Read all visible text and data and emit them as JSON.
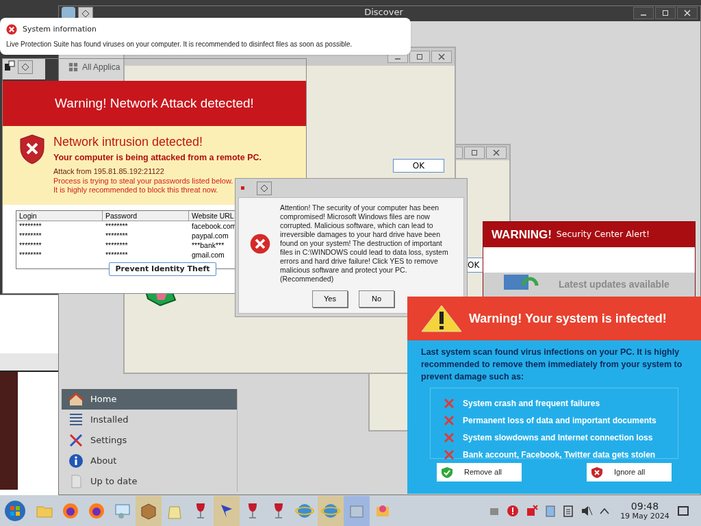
{
  "discover_window": {
    "title": "Discover",
    "category": "All Applica",
    "sidebar": [
      {
        "label": "Home",
        "kind": "home",
        "selected": true
      },
      {
        "label": "Installed",
        "kind": "list",
        "selected": false
      },
      {
        "label": "Settings",
        "kind": "tools",
        "selected": false
      },
      {
        "label": "About",
        "kind": "info",
        "selected": false
      },
      {
        "label": "Up to date",
        "kind": "update",
        "selected": false
      }
    ]
  },
  "background_dialogs": [
    {
      "button": "OK"
    },
    {
      "button": "OK"
    }
  ],
  "notification": {
    "title": "System information",
    "message": "Live Protection Suite has found viruses on your computer. It is recommended to disinfect files as soon as possible."
  },
  "network_attack": {
    "header": "Warning! Network Attack detected!",
    "title": "Network intrusion detected!",
    "subtitle": "Your computer is being attacked from a remote PC.",
    "attack_from": "Attack from 195.81.85.192:21122",
    "lines": [
      "Process is trying to steal your passwords listed below.",
      "It is highly recommended to block this threat now."
    ],
    "table": {
      "columns": [
        "Login",
        "Password",
        "Website URL"
      ],
      "rows": [
        [
          "********",
          "********",
          "facebook.com"
        ],
        [
          "********",
          "********",
          "paypal.com"
        ],
        [
          "********",
          "********",
          "***bank***"
        ],
        [
          "********",
          "********",
          "gmail.com"
        ]
      ]
    },
    "button": "Prevent Identity Theft"
  },
  "attention_dialog": {
    "message": "Attention! The security of your computer has been compromised! Microsoft Windows files are now corrupted. Malicious software, which can lead to irreversible damages to your hard drive have been found on your system! The destruction of important files in C:\\WINDOWS could lead to data loss, system errors and hard drive failure! Click YES to remove malicious software and protect your PC. (Recommended)",
    "buttons": [
      "Yes",
      "No"
    ]
  },
  "security_alert": {
    "title": "WARNING!",
    "subtitle": "Security Center Alert!",
    "update_text": "Latest updates available"
  },
  "infected_window": {
    "title": "Warning! Your system is infected!",
    "message": "Last system scan found virus infections on your PC. It is highly recommended to remove them immediately from your system to prevent damage such as:",
    "risks": [
      "System crash and frequent failures",
      "Permanent loss of data and important documents",
      "System slowdowns and Internet connection loss",
      "Bank account, Facebook, Twitter data gets stolen"
    ],
    "buttons": [
      {
        "label": "Remove all",
        "kind": "remove"
      },
      {
        "label": "Ignore all",
        "kind": "ignore"
      }
    ]
  },
  "taskbar": {
    "time": "09:48",
    "date": "19 May 2024"
  }
}
